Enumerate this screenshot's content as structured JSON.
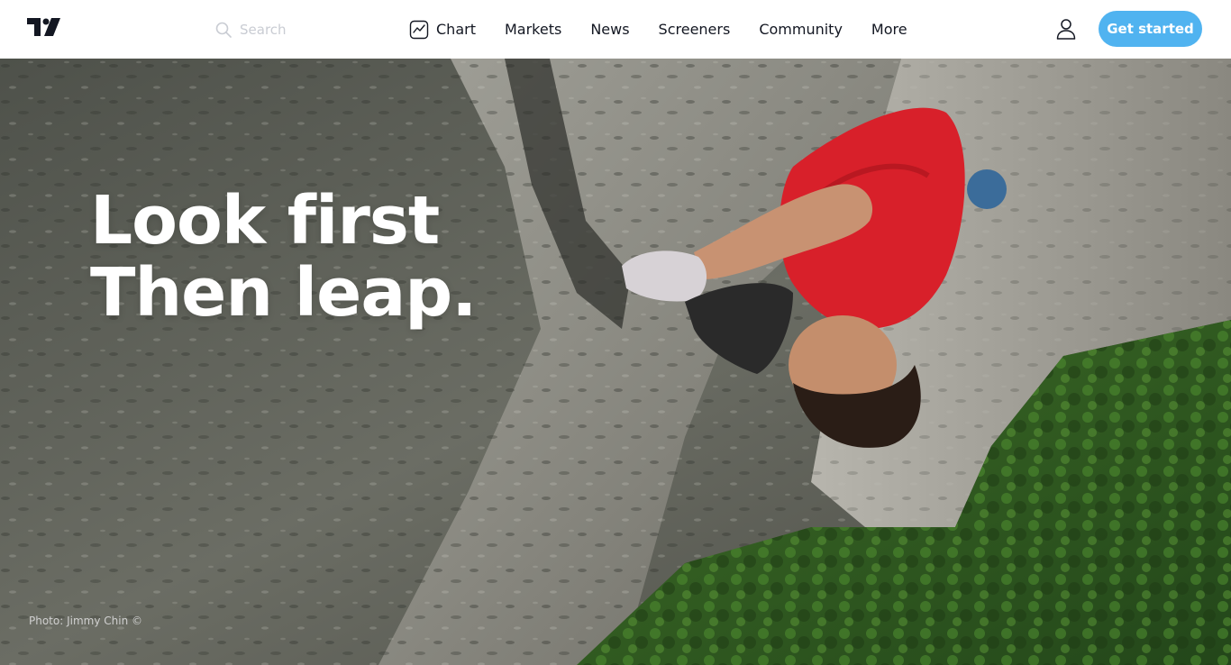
{
  "header": {
    "logo_name": "tradingview-logo",
    "search": {
      "placeholder": "Search",
      "value": "",
      "icon": "search-icon"
    },
    "nav": [
      {
        "label": "Chart",
        "icon": "chart-icon"
      },
      {
        "label": "Markets"
      },
      {
        "label": "News"
      },
      {
        "label": "Screeners"
      },
      {
        "label": "Community"
      },
      {
        "label": "More"
      }
    ],
    "user_icon": "user-icon",
    "cta_label": "Get started"
  },
  "hero": {
    "headline_line1": "Look first",
    "headline_line2": "Then leap.",
    "photo_credit": "Photo: Jimmy Chin ©"
  },
  "colors": {
    "accent": "#50b3f0",
    "text": "#131722",
    "headline": "#ffffff",
    "climber_shirt": "#d8202a",
    "forest": "#2f5a1e",
    "rock": "#8c8b83"
  }
}
